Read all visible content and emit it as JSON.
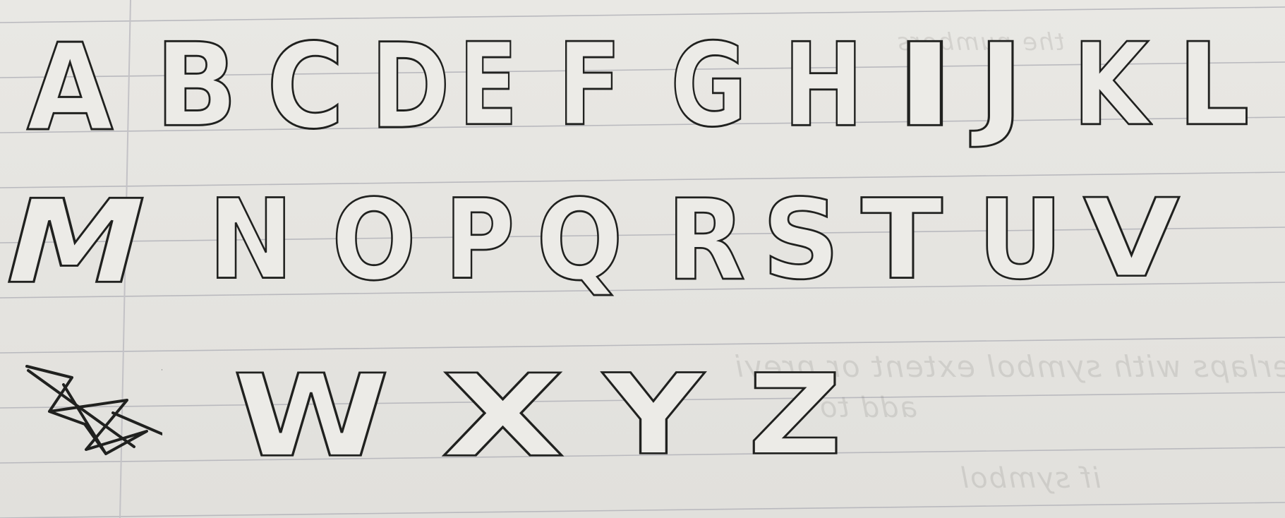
{
  "paper": {
    "ghost_lines": [
      "the numbers",
      "it extent overlaps with symbol extent or previ",
      "add to",
      "if symbol"
    ]
  },
  "alphabet": {
    "row1": [
      "A",
      "B",
      "C",
      "D",
      "E",
      "F",
      "G",
      "H",
      "I",
      "J",
      "K",
      "L"
    ],
    "row2": [
      "M",
      "N",
      "O",
      "P",
      "Q",
      "R",
      "S",
      "T",
      "U",
      "V"
    ],
    "row3": [
      "W",
      "X",
      "Y",
      "Z"
    ]
  },
  "colors": {
    "paper": "#e6e5e1",
    "rule_line": "#b9b9be",
    "margin_line": "#c3c2c6",
    "ink": "#20211f",
    "letter_fill": "#ecebe7"
  }
}
